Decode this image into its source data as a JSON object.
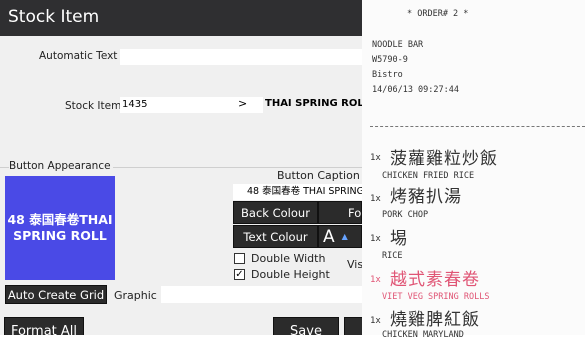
{
  "window": {
    "title": "Stock Item"
  },
  "form": {
    "automatic_text_label": "Automatic Text",
    "automatic_text_value": "",
    "stock_item_label": "Stock Item",
    "stock_item_code": "1435",
    "stock_item_arrow": ">",
    "stock_item_name": "THAI SPRING ROLL"
  },
  "button_appearance": {
    "section_label": "Button Appearance",
    "preview_line1": "48 泰国春卷THAI",
    "preview_line2": "SPRING ROLL",
    "preview_bg": "#4a4ae6",
    "caption_label": "Button Caption",
    "caption_value": "48 泰国春卷 THAI SPRING",
    "back_colour_label": "Back Colour",
    "text_colour_label": "Text Colour",
    "fore_label": "Fo",
    "font_glyph": "A",
    "double_width_label": "Double Width",
    "double_width_checked": false,
    "double_height_label": "Double Height",
    "double_height_checked": true,
    "vis_label": "Vis",
    "auto_create_grid_label": "Auto Create Grid",
    "graphic_label": "Graphic"
  },
  "footer": {
    "format_all_label": "Format All",
    "save_label": "Save"
  },
  "receipt": {
    "header": "* ORDER# 2 *",
    "shop": "NOODLE BAR",
    "id": "W5790-9",
    "venue": "Bistro",
    "datetime": "14/06/13 09:27:44",
    "items": [
      {
        "qty": "1x",
        "zh": "菠蘿雞粒炒飯",
        "en": "CHICKEN FRIED RICE",
        "highlight": false
      },
      {
        "qty": "1x",
        "zh": "烤豬扒湯",
        "en": "PORK CHOP",
        "highlight": false
      },
      {
        "qty": "1x",
        "zh": "埸",
        "en": "RICE",
        "highlight": false
      },
      {
        "qty": "1x",
        "zh": "越式素春卷",
        "en": "VIET VEG SPRING ROLLS",
        "highlight": true
      },
      {
        "qty": "1x",
        "zh": "燒雞脾紅飯",
        "en": "CHICKEN MARYLAND",
        "highlight": false
      }
    ]
  }
}
